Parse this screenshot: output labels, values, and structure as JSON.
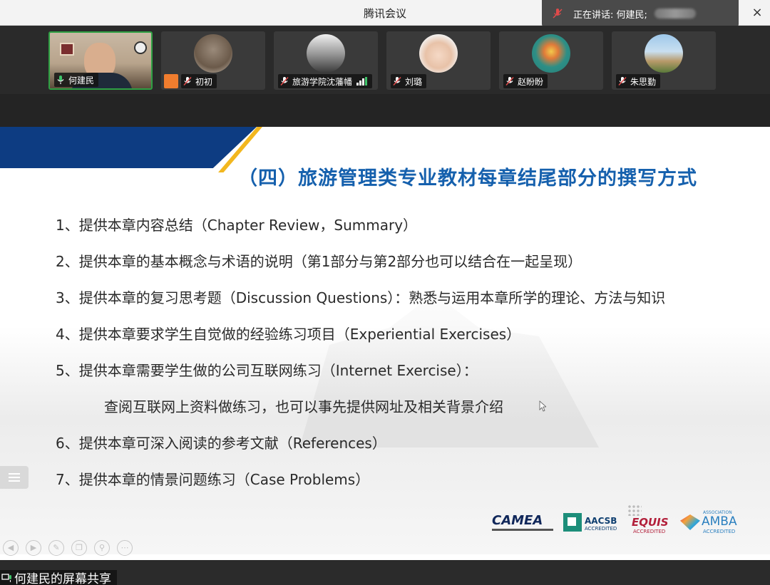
{
  "window": {
    "title": "腾讯会议",
    "speaking_text": "正在讲话: 何建民;",
    "close_glyph": "×"
  },
  "participants": [
    {
      "name": "何建民",
      "active": true
    },
    {
      "name": "初初",
      "active": false
    },
    {
      "name": "旅游学院沈藩幡",
      "active": false
    },
    {
      "name": "刘璐",
      "active": false
    },
    {
      "name": "赵盼盼",
      "active": false
    },
    {
      "name": "朱思勤",
      "active": false
    }
  ],
  "slide": {
    "title": "（四）旅游管理类专业教材每章结尾部分的撰写方式",
    "lines": [
      "1、提供本章内容总结（Chapter Review，Summary）",
      "2、提供本章的基本概念与术语的说明（第1部分与第2部分也可以结合在一起呈现）",
      "3、提供本章的复习思考题（Discussion Questions）：熟悉与运用本章所学的理论、方法与知识",
      "4、提供本章要求学生自觉做的经验练习项目（Experiential Exercises）",
      "5、提供本章需要学生做的公司互联网练习（Internet Exercise）：",
      "查阅互联网上资料做练习，也可以事先提供网址及相关背景介绍",
      "6、提供本章可深入阅读的参考文献（References）",
      "7、提供本章的情景问题练习（Case Problems）"
    ],
    "logos": {
      "camea": "CAMEA",
      "aacsb": "AACSB",
      "aacsb_sub": "ACCREDITED",
      "equis": "EQUIS",
      "equis_sub": "ACCREDITED",
      "amba": "AMBA",
      "amba_top": "ASSOCIATION",
      "amba_sub": "ACCREDITED"
    }
  },
  "bottom": {
    "share_label": "何建民的屏幕共享"
  },
  "icons": [
    "mic-muted-icon",
    "mic-active-icon",
    "signal-bars-icon",
    "menu-list-icon",
    "close-icon",
    "screen-share-icon"
  ]
}
